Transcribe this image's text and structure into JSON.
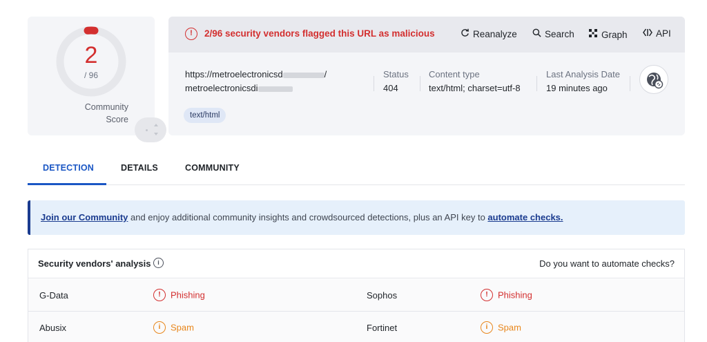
{
  "score": {
    "detections": "2",
    "total": "/ 96",
    "community_label_line1": "Community",
    "community_label_line2": "Score",
    "ratio": 0.0208
  },
  "header": {
    "alert_text": "2/96 security vendors flagged this URL as malicious",
    "actions": {
      "reanalyze": "Reanalyze",
      "search": "Search",
      "graph": "Graph",
      "api": "API"
    }
  },
  "url": {
    "line1_prefix": "https://metroelectronicsd",
    "line1_suffix": "/",
    "line2_prefix": "metroelectronicsdi"
  },
  "meta": {
    "status_label": "Status",
    "status_value": "404",
    "content_type_label": "Content type",
    "content_type_value": "text/html; charset=utf-8",
    "date_label": "Last Analysis Date",
    "date_value": "19 minutes ago",
    "tag": "text/html"
  },
  "tabs": [
    {
      "label": "DETECTION",
      "active": true
    },
    {
      "label": "DETAILS",
      "active": false
    },
    {
      "label": "COMMUNITY",
      "active": false
    }
  ],
  "banner": {
    "link1": "Join our Community",
    "middle": " and enjoy additional community insights and crowdsourced detections, plus an API key to ",
    "link2": "automate checks."
  },
  "vendors": {
    "title": "Security vendors' analysis",
    "automate_prompt": "Do you want to automate checks?",
    "rows": [
      {
        "left_vendor": "G-Data",
        "left_result": "Phishing",
        "right_vendor": "Sophos",
        "right_result": "Phishing"
      },
      {
        "left_vendor": "Abusix",
        "left_result": "Spam",
        "right_vendor": "Fortinet",
        "right_result": "Spam"
      }
    ]
  },
  "colors": {
    "malicious": "#d32f2f",
    "suspicious": "#e8861b",
    "accent": "#1a56c4"
  }
}
